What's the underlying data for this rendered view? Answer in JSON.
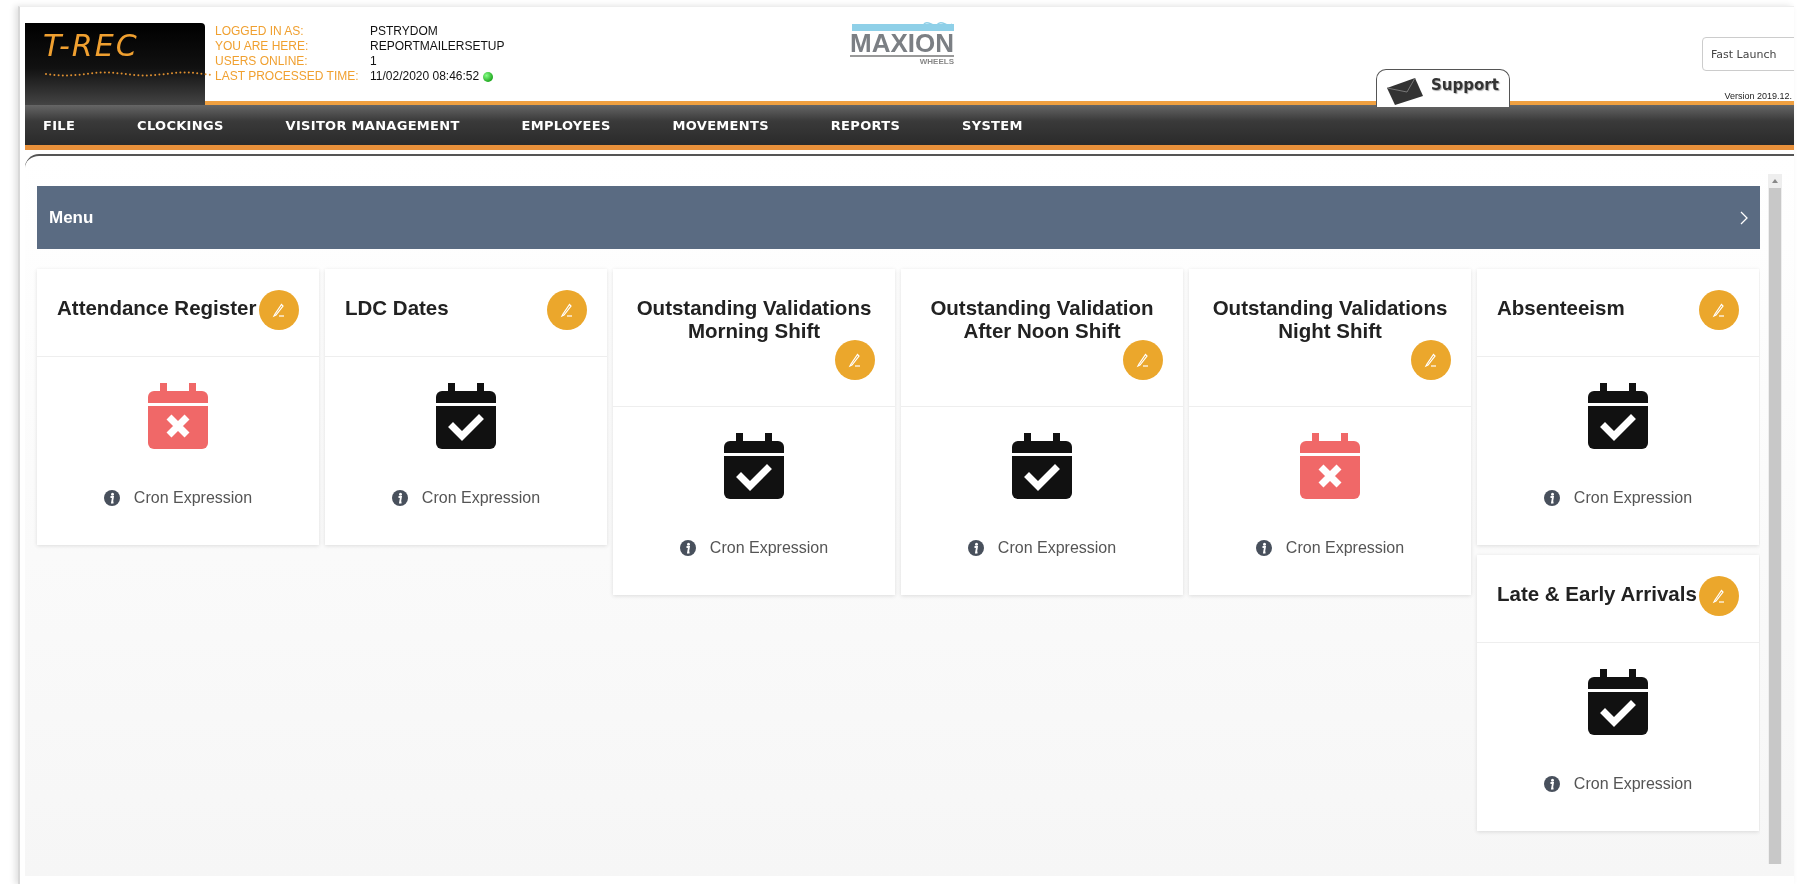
{
  "header": {
    "logo": {
      "text": "T-REC"
    },
    "session": [
      {
        "label": "LOGGED IN AS:",
        "value": "PSTRYDOM",
        "indicator": false
      },
      {
        "label": "YOU ARE HERE:",
        "value": "REPORTMAILERSETUP",
        "indicator": false
      },
      {
        "label": "USERS ONLINE:",
        "value": "1",
        "indicator": false
      },
      {
        "label": "LAST PROCESSED TIME:",
        "value": "11/02/2020 08:46:52",
        "indicator": true
      }
    ],
    "company_logo": {
      "name": "MAXION",
      "tagline": "WHEELS"
    },
    "support_tab": {
      "label": "Support"
    },
    "fast_launch": {
      "placeholder": "Fast Launch"
    },
    "version": "Version 2019.12."
  },
  "nav": [
    "FILE",
    "CLOCKINGS",
    "VISITOR MANAGEMENT",
    "EMPLOYEES",
    "MOVEMENTS",
    "REPORTS",
    "SYSTEM"
  ],
  "panel": {
    "title": "Menu"
  },
  "columns": [
    [
      {
        "title": "Attendance Register",
        "kind": "cross",
        "caption": "Cron Expression"
      }
    ],
    [
      {
        "title": "LDC Dates",
        "kind": "check",
        "caption": "Cron Expression"
      }
    ],
    [
      {
        "title": "Outstanding Validations Morning Shift",
        "kind": "check",
        "caption": "Cron Expression"
      }
    ],
    [
      {
        "title": "Outstanding Validation After Noon Shift",
        "kind": "check",
        "caption": "Cron Expression"
      }
    ],
    [
      {
        "title": "Outstanding Validations Night Shift",
        "kind": "cross",
        "caption": "Cron Expression"
      }
    ],
    [
      {
        "title": "Absenteeism",
        "kind": "check",
        "caption": "Cron Expression"
      },
      {
        "title": "Late & Early Arrivals",
        "kind": "check",
        "caption": "Cron Expression"
      }
    ]
  ]
}
